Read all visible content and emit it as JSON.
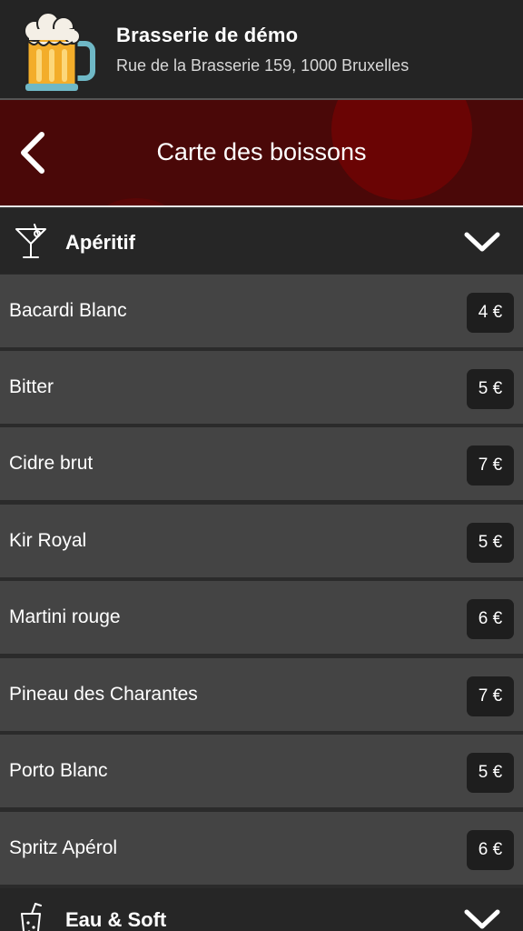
{
  "brand": {
    "name": "Brasserie de démo",
    "address": "Rue de la Brasserie 159, 1000 Bruxelles",
    "logo_icon": "beer-mug-icon"
  },
  "titlebar": {
    "title": "Carte des boissons",
    "back_icon": "chevron-left-icon",
    "accent_color": "#4a0808"
  },
  "categories": [
    {
      "label": "Apéritif",
      "icon": "cocktail-glass-icon",
      "expanded": true,
      "items": [
        {
          "name": "Bacardi Blanc",
          "price": "4 €"
        },
        {
          "name": "Bitter",
          "price": "5 €"
        },
        {
          "name": "Cidre brut",
          "price": "7 €"
        },
        {
          "name": "Kir Royal",
          "price": "5 €"
        },
        {
          "name": "Martini rouge",
          "price": "6 €"
        },
        {
          "name": "Pineau des Charantes",
          "price": "7 €"
        },
        {
          "name": "Porto Blanc",
          "price": "5 €"
        },
        {
          "name": "Spritz Apérol",
          "price": "6 €"
        }
      ]
    },
    {
      "label": "Eau & Soft",
      "icon": "soda-cup-icon",
      "expanded": false,
      "items": []
    }
  ]
}
